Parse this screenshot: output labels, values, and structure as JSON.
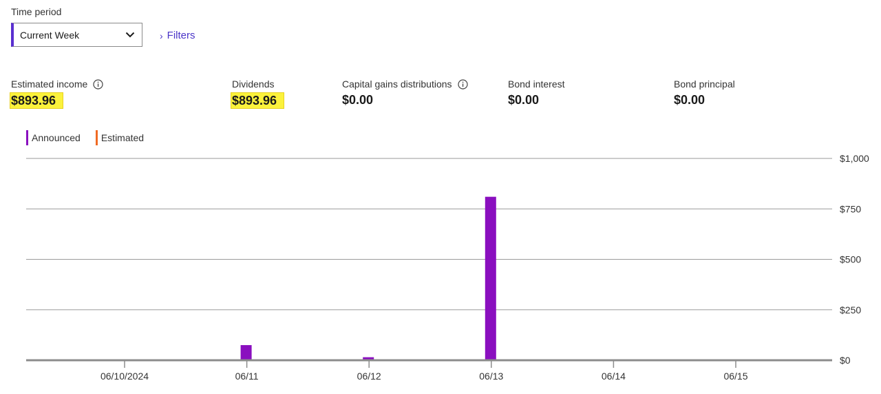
{
  "time_period": {
    "label": "Time period",
    "selected": "Current Week"
  },
  "filters_label": "Filters",
  "metrics": {
    "estimated_income": {
      "label": "Estimated income",
      "value": "$893.96"
    },
    "dividends": {
      "label": "Dividends",
      "value": "$893.96"
    },
    "capital_gains": {
      "label": "Capital gains distributions",
      "value": "$0.00"
    },
    "bond_interest": {
      "label": "Bond interest",
      "value": "$0.00"
    },
    "bond_principal": {
      "label": "Bond principal",
      "value": "$0.00"
    }
  },
  "legend": {
    "announced": {
      "label": "Announced",
      "color": "#8a0fbf"
    },
    "estimated": {
      "label": "Estimated",
      "color": "#f06a23"
    }
  },
  "highlight_color": "#fbf23c",
  "chart_data": {
    "type": "bar",
    "categories": [
      "06/10/2024",
      "06/11",
      "06/12",
      "06/13",
      "06/14",
      "06/15"
    ],
    "series": [
      {
        "name": "Announced",
        "values": [
          0,
          75,
          15,
          810,
          0,
          0
        ]
      },
      {
        "name": "Estimated",
        "values": [
          0,
          0,
          0,
          0,
          0,
          0
        ]
      }
    ],
    "y_ticks": [
      0,
      250,
      500,
      750,
      1000
    ],
    "y_tick_labels": [
      "$0",
      "$250",
      "$500",
      "$750",
      "$1,000"
    ],
    "ylim": [
      0,
      1000
    ],
    "grid": true,
    "y_axis_side": "right"
  }
}
